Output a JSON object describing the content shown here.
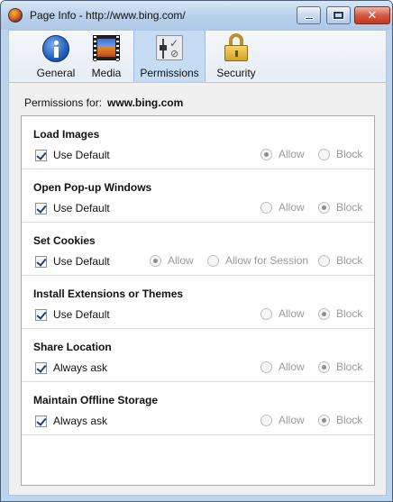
{
  "window": {
    "title": "Page Info - http://www.bing.com/"
  },
  "tabs": [
    {
      "label": "General",
      "icon": "info-icon",
      "selected": false
    },
    {
      "label": "Media",
      "icon": "film-icon",
      "selected": false
    },
    {
      "label": "Permissions",
      "icon": "permissions-icon",
      "selected": true
    },
    {
      "label": "Security",
      "icon": "padlock-icon",
      "selected": false
    }
  ],
  "permissions_for": {
    "label": "Permissions for:",
    "host": "www.bing.com"
  },
  "sections": [
    {
      "title": "Load Images",
      "checkbox_label": "Use Default",
      "checked": true,
      "options": [
        {
          "label": "Allow",
          "selected": true
        },
        {
          "label": "Block",
          "selected": false
        }
      ]
    },
    {
      "title": "Open Pop-up Windows",
      "checkbox_label": "Use Default",
      "checked": true,
      "options": [
        {
          "label": "Allow",
          "selected": false
        },
        {
          "label": "Block",
          "selected": true
        }
      ]
    },
    {
      "title": "Set Cookies",
      "checkbox_label": "Use Default",
      "checked": true,
      "options": [
        {
          "label": "Allow",
          "selected": true
        },
        {
          "label": "Allow for Session",
          "selected": false
        },
        {
          "label": "Block",
          "selected": false
        }
      ]
    },
    {
      "title": "Install Extensions or Themes",
      "checkbox_label": "Use Default",
      "checked": true,
      "options": [
        {
          "label": "Allow",
          "selected": false
        },
        {
          "label": "Block",
          "selected": true
        }
      ]
    },
    {
      "title": "Share Location",
      "checkbox_label": "Always ask",
      "checked": true,
      "options": [
        {
          "label": "Allow",
          "selected": false
        },
        {
          "label": "Block",
          "selected": true
        }
      ]
    },
    {
      "title": "Maintain Offline Storage",
      "checkbox_label": "Always ask",
      "checked": true,
      "options": [
        {
          "label": "Allow",
          "selected": false
        },
        {
          "label": "Block",
          "selected": true
        }
      ]
    }
  ]
}
